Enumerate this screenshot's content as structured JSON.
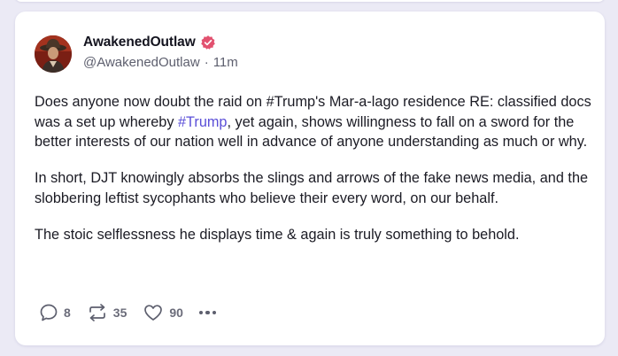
{
  "post": {
    "author": {
      "display_name": "AwakenedOutlaw",
      "handle": "@AwakenedOutlaw",
      "separator": "·",
      "time": "11m",
      "verified_color": "#e2516f"
    },
    "paragraphs": {
      "p1_part1": "Does anyone now doubt the raid on #Trump's Mar-a-lago residence RE: classified docs was a set up whereby ",
      "p1_hashtag": "#Trump",
      "p1_part2": ", yet again, shows willingness to fall on a sword for the better interests of our nation well in advance of anyone understanding as much or why.",
      "p2": "In short, DJT knowingly absorbs the slings and arrows of the fake news media, and the slobbering leftist sycophants who believe their every word, on our behalf.",
      "p3": "The stoic selflessness he displays time & again is truly something to behold."
    },
    "actions": {
      "replies": "8",
      "reposts": "35",
      "likes": "90"
    },
    "icons": {
      "reply": "speech-bubble-icon",
      "repost": "repost-arrows-icon",
      "like": "heart-icon",
      "more": "more-dots-icon",
      "verified": "verified-badge-icon"
    },
    "colors": {
      "hashtag": "#5b4fd8",
      "background": "#ebeaf5"
    }
  }
}
